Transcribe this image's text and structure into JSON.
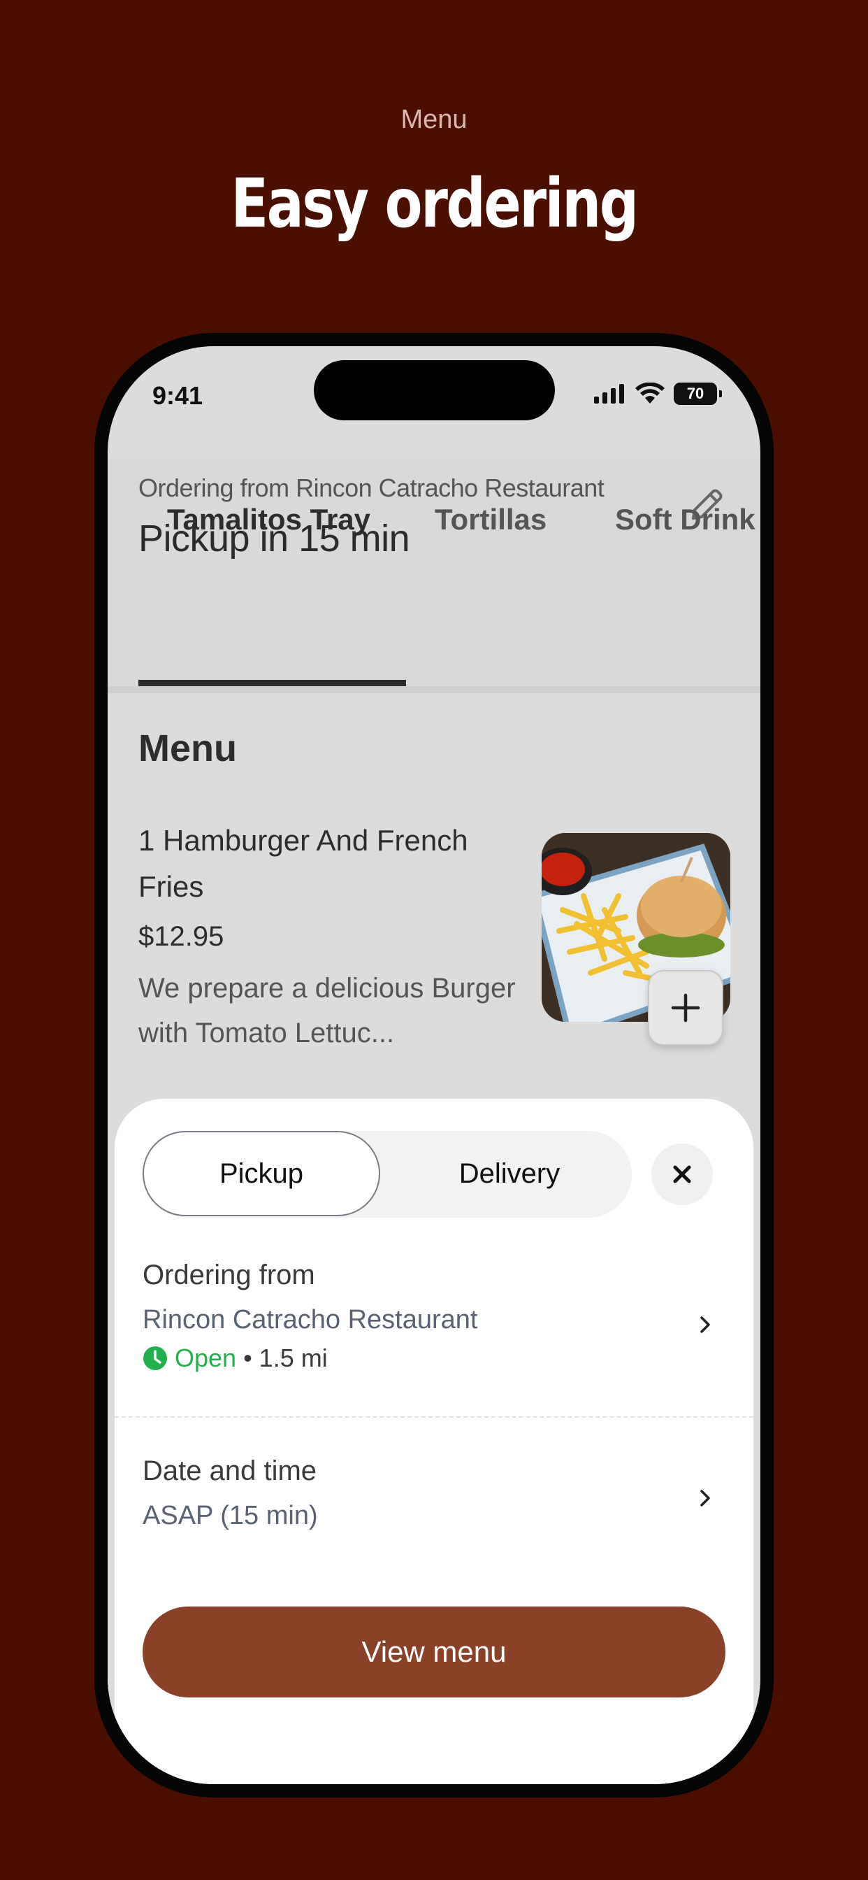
{
  "marketing": {
    "label": "Menu",
    "title": "Easy ordering"
  },
  "status_bar": {
    "time": "9:41",
    "battery": "70"
  },
  "header": {
    "ordering_from": "Ordering from Rincon Catracho Restaurant",
    "pickup_time": "Pickup in 15 min"
  },
  "tabs": [
    "Tamalitos Tray",
    "Tortillas",
    "Soft Drink"
  ],
  "menu": {
    "heading": "Menu",
    "item": {
      "name": "1 Hamburger And French Fries",
      "price": "$12.95",
      "description": "We prepare a delicious Burger with Tomato Lettuc..."
    }
  },
  "sheet": {
    "segment_pickup": "Pickup",
    "segment_delivery": "Delivery",
    "ordering_label": "Ordering from",
    "restaurant": "Rincon Catracho Restaurant",
    "open_status": "Open",
    "distance": "• 1.5 mi",
    "date_label": "Date and time",
    "date_value": "ASAP (15 min)",
    "view_menu": "View menu"
  },
  "colors": {
    "background": "#4b0f02",
    "accent": "#8b4128",
    "open_green": "#21b04b"
  }
}
